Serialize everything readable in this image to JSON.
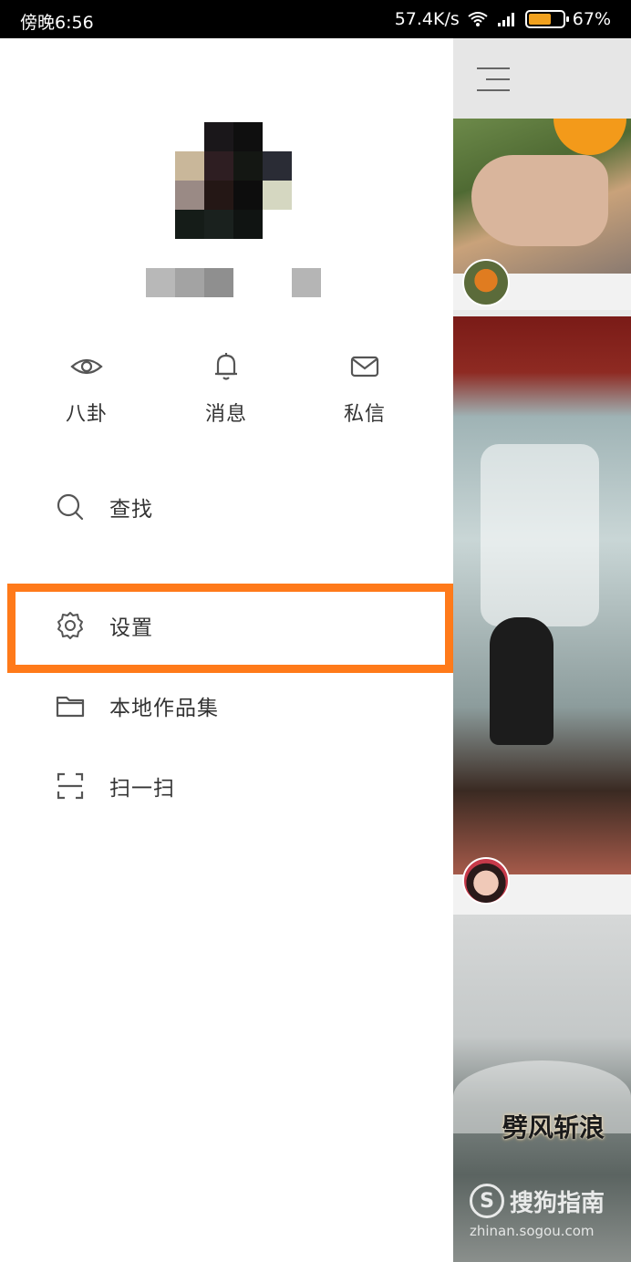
{
  "status_bar": {
    "time": "傍晚6:56",
    "network_speed": "57.4K/s",
    "battery_percent": "67%",
    "battery_level": 0.67,
    "battery_color": "#f2a21f"
  },
  "drawer": {
    "quick_actions": [
      {
        "label": "八卦",
        "icon": "eye-icon"
      },
      {
        "label": "消息",
        "icon": "bell-icon"
      },
      {
        "label": "私信",
        "icon": "mail-icon"
      }
    ],
    "menu": [
      {
        "label": "查找",
        "icon": "search-icon"
      },
      {
        "label": "设置",
        "icon": "gear-icon",
        "highlighted": true
      },
      {
        "label": "本地作品集",
        "icon": "folder-icon"
      },
      {
        "label": "扫一扫",
        "icon": "scan-icon"
      }
    ],
    "highlight_color": "#ff7a1a"
  },
  "feed": {
    "menu_icon": "hamburger-menu-icon",
    "card3_caption": "劈风斩浪",
    "watermark_logo": "S",
    "watermark_brand": "搜狗指南",
    "watermark_url": "zhinan.sogou.com"
  }
}
